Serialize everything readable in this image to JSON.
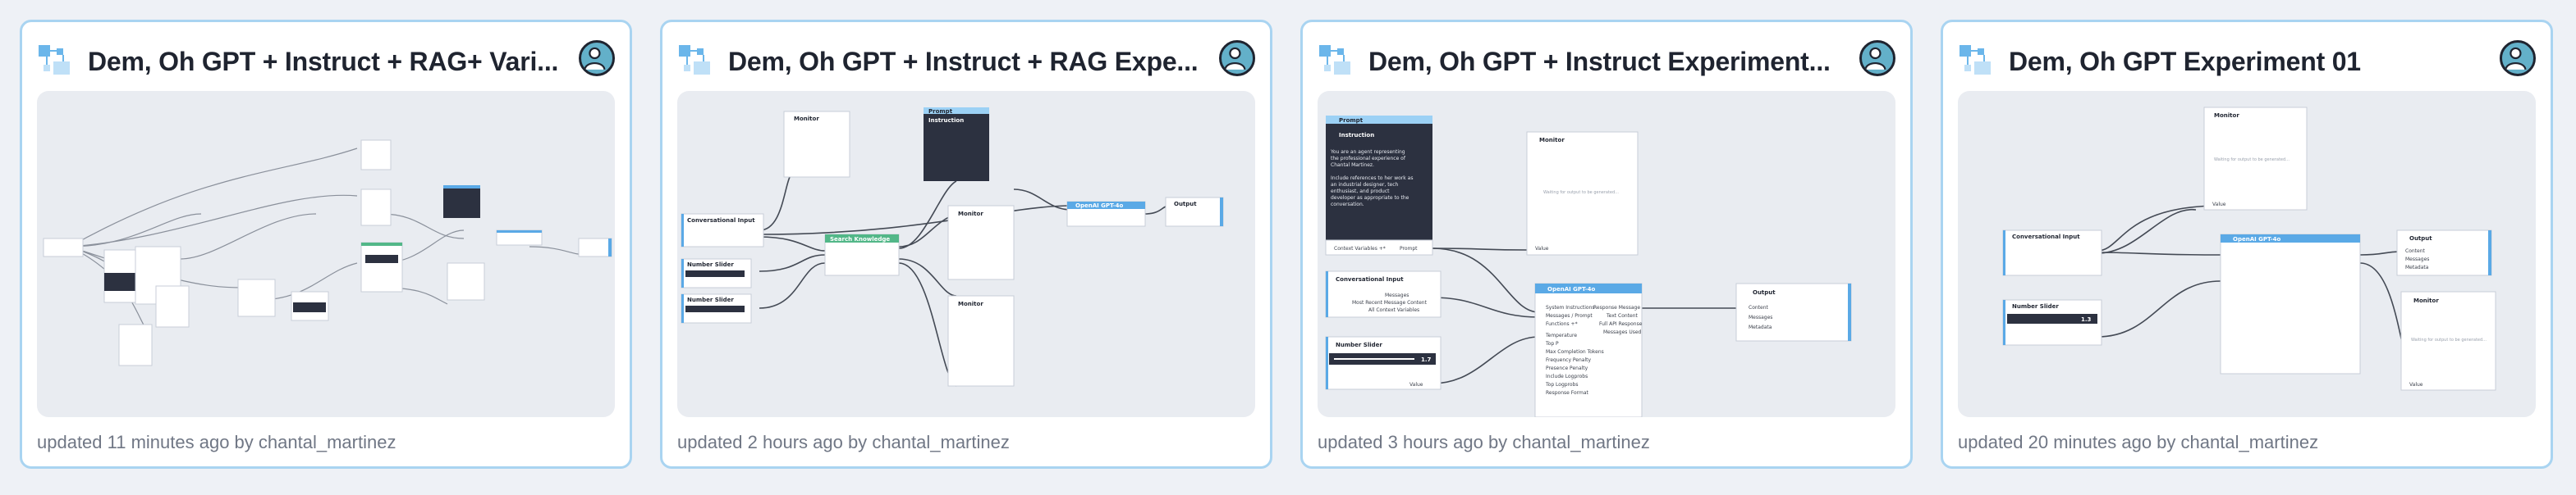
{
  "accent_color": "#a9d4f1",
  "cards": [
    {
      "title": "Dem, Oh GPT + Instruct + RAG+ Vari...",
      "updated": "updated 11 minutes ago by",
      "author": "chantal_martinez",
      "logo_icon": "flow-logo-icon",
      "avatar_icon": "user-avatar-icon"
    },
    {
      "title": "Dem, Oh GPT + Instruct + RAG Expe...",
      "updated": "updated 2 hours ago by",
      "author": "chantal_martinez",
      "logo_icon": "flow-logo-icon",
      "avatar_icon": "user-avatar-icon",
      "preview": {
        "monitor": "Monitor",
        "prompt": "Prompt",
        "instruction": "Instruction",
        "conversational_input": "Conversational Input",
        "number_slider": "Number Slider",
        "search_knowledge": "Search Knowledge",
        "openai": "OpenAI GPT-4o",
        "output": "Output"
      }
    },
    {
      "title": "Dem, Oh GPT + Instruct Experiment...",
      "updated": "updated 3 hours ago by",
      "author": "chantal_martinez",
      "logo_icon": "flow-logo-icon",
      "avatar_icon": "user-avatar-icon",
      "preview": {
        "prompt": "Prompt",
        "instruction": "Instruction",
        "instruction_text_1": "You are an agent representing",
        "instruction_text_2": "the professional experience of",
        "instruction_text_3": "Chantal Martinez.",
        "instruction_text_4": "Include references to her work as",
        "instruction_text_5": "an industrial designer, tech",
        "instruction_text_6": "enthusiast, and product",
        "instruction_text_7": "developer as appropriate to the",
        "instruction_text_8": "conversation.",
        "context_variables": "Context Variables +*",
        "prompt_port": "Prompt",
        "monitor": "Monitor",
        "monitor_placeholder": "Waiting for output to be generated...",
        "value": "Value",
        "conversational_input": "Conversational Input",
        "messages": "Messages",
        "most_recent": "Most Recent Message Content",
        "all_context": "All Context Variables",
        "number_slider": "Number Slider",
        "slider_value": "1.7",
        "openai": "OpenAI GPT-4o",
        "system_instructions": "System Instructions",
        "messages_prompt": "Messages / Prompt",
        "functions": "Functions +*",
        "temperature": "Temperature",
        "top_p": "Top P",
        "max_completion": "Max Completion Tokens",
        "frequency_penalty": "Frequency Penalty",
        "presence_penalty": "Presence Penalty",
        "include_logprobs": "Include Logprobs",
        "top_logprobs": "Top Logprobs",
        "response_format": "Response Format",
        "response_message": "Response Message",
        "text_content": "Text Content",
        "full_api_response": "Full API Response",
        "messages_used": "Messages Used",
        "output": "Output",
        "content": "Content",
        "metadata": "Metadata"
      }
    },
    {
      "title": "Dem, Oh GPT Experiment 01",
      "updated": "updated 20 minutes ago by",
      "author": "chantal_martinez",
      "logo_icon": "flow-logo-icon",
      "avatar_icon": "user-avatar-icon",
      "preview": {
        "monitor": "Monitor",
        "monitor_placeholder": "Waiting for output to be generated...",
        "conversational_input": "Conversational Input",
        "number_slider": "Number Slider",
        "slider_value": "1.3",
        "openai": "OpenAI GPT-4o",
        "output": "Output",
        "content": "Content",
        "messages": "Messages",
        "metadata": "Metadata",
        "value": "Value"
      }
    }
  ]
}
